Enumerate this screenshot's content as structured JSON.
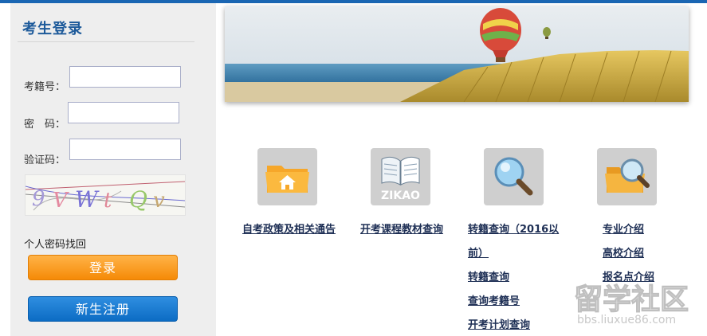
{
  "login": {
    "title": "考生登录",
    "fields": {
      "exam_id_label": "考籍号：",
      "password_label": "密　码：",
      "captcha_label": "验证码："
    },
    "captcha_text": "9VWtQv",
    "forgot_label": "个人密码找回",
    "login_button": "登录",
    "register_button": "新生注册"
  },
  "tiles": [
    {
      "icon": "home-folder-icon",
      "label": "自考政策及相关通告"
    },
    {
      "icon": "zikao-book-icon",
      "icon_text": "ZIKAO",
      "label": "开考课程教材查询"
    },
    {
      "icon": "magnifier-icon",
      "label": "转籍查询（2016以前）"
    },
    {
      "icon": "folder-search-icon",
      "label": "专业介绍"
    }
  ],
  "column3_links": [
    "转籍查询（2016以",
    "前）",
    "转籍查询",
    "查询考籍号",
    "开考计划查询"
  ],
  "column4_links": [
    "专业介绍",
    "高校介绍",
    "报名点介绍"
  ],
  "watermark": {
    "brand": "留学社区",
    "url": "bbs.liuxue86.com"
  },
  "colors": {
    "topbar": "#1a66b3",
    "title": "#1d5a9a",
    "login_button": "#f58a07",
    "register_button": "#0c6cc4",
    "link": "#1e2f55"
  }
}
